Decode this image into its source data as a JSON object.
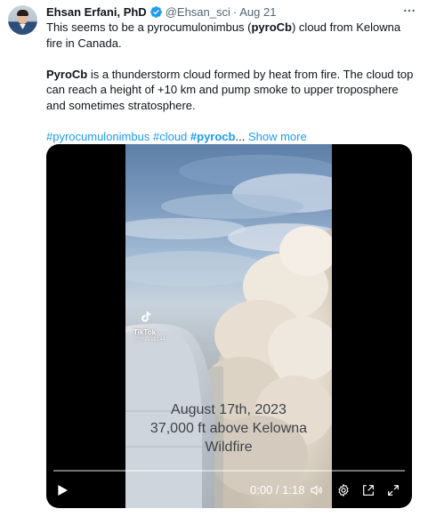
{
  "author": {
    "name": "Ehsan Erfani, PhD",
    "handle": "@Ehsan_sci",
    "separator": "·",
    "date": "Aug 21"
  },
  "tweet": {
    "p1_before": "This seems to be a pyrocumulonimbus (",
    "p1_bold": "pyroCb",
    "p1_after": ") cloud from Kelowna fire in Canada.",
    "p2_bold": "PyroCb",
    "p2_after": " is a thunderstorm cloud formed by heat from fire. The cloud top can reach a height of +10 km and pump smoke to upper troposphere and sometimes stratosphere.",
    "hashtag1": "#pyrocumulonimbus",
    "hashtag2": "#cloud",
    "hashtag3": "#pyrocb",
    "ellipsis": "...",
    "show_more": "Show more"
  },
  "video": {
    "watermark_brand": "TikTok",
    "watermark_user": "@ mifire8144",
    "caption_line1": "August 17th, 2023",
    "caption_line2": "37,000 ft above Kelowna",
    "caption_line3": "Wildfire",
    "current_time": "0:00",
    "time_separator": " / ",
    "duration": "1:18",
    "progress": 0
  },
  "colors": {
    "link": "#1d9bf0",
    "muted": "#536471",
    "text": "#0f1419",
    "verified": "#1d9bf0"
  },
  "icons": [
    "verified-badge-icon",
    "more-icon",
    "tiktok-logo-icon",
    "play-icon",
    "volume-icon",
    "settings-icon",
    "pip-icon",
    "fullscreen-icon"
  ]
}
